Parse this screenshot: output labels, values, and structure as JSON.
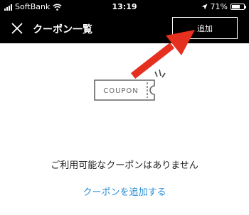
{
  "status_bar": {
    "carrier": "SoftBank",
    "time": "13:19",
    "battery_percent": "71%",
    "battery_level": 0.71,
    "icons": [
      "signal-icon",
      "wifi-icon",
      "location-icon",
      "battery-icon"
    ]
  },
  "header": {
    "title": "クーポン一覧",
    "add_label": "追加",
    "close_icon": "close-icon",
    "background": "#000000"
  },
  "annotation": {
    "arrow_color": "#e53020"
  },
  "illustration": {
    "coupon_text": "COUPON"
  },
  "main": {
    "empty_message": "ご利用可能なクーポンはありません",
    "add_coupon_link": "クーポンを追加する",
    "link_color": "#2a8fd6"
  }
}
